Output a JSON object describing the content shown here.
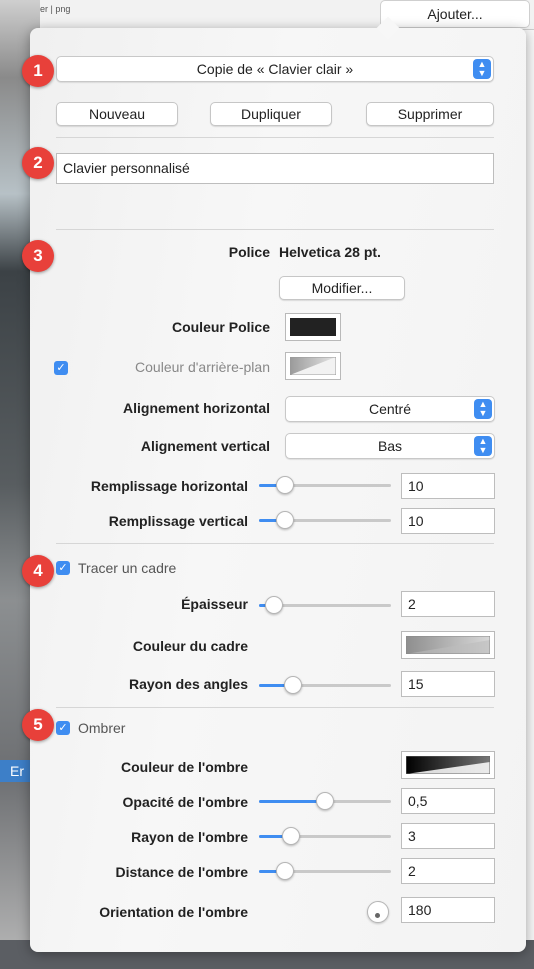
{
  "background": {
    "breadcrumb": "me dossier | png",
    "add_button": "Ajouter...",
    "strip_text": "Er"
  },
  "badges": [
    "1",
    "2",
    "3",
    "4",
    "5"
  ],
  "preset": {
    "selected": "Copie de « Clavier clair »",
    "new_label": "Nouveau",
    "duplicate_label": "Dupliquer",
    "delete_label": "Supprimer"
  },
  "name_field": {
    "value": "Clavier personnalisé"
  },
  "font": {
    "label": "Police",
    "value": "Helvetica 28 pt.",
    "modify_label": "Modifier...",
    "color_label": "Couleur Police",
    "color": "#222222",
    "bg_checked": true,
    "bg_label": "Couleur d'arrière-plan"
  },
  "alignment": {
    "h_label": "Alignement horizontal",
    "h_value": "Centré",
    "v_label": "Alignement vertical",
    "v_value": "Bas"
  },
  "padding": {
    "h_label": "Remplissage horizontal",
    "h_value": "10",
    "h_level": 0.15,
    "v_label": "Remplissage vertical",
    "v_value": "10",
    "v_level": 0.15
  },
  "border": {
    "checked": true,
    "label": "Tracer un cadre",
    "thickness_label": "Épaisseur",
    "thickness_value": "2",
    "thickness_level": 0.05,
    "color_label": "Couleur du cadre",
    "radius_label": "Rayon des angles",
    "radius_value": "15",
    "radius_level": 0.22
  },
  "shadow": {
    "checked": true,
    "label": "Ombrer",
    "color_label": "Couleur de l'ombre",
    "opacity_label": "Opacité de l'ombre",
    "opacity_value": "0,5",
    "opacity_level": 0.5,
    "radius_label": "Rayon de l'ombre",
    "radius_value": "3",
    "radius_level": 0.2,
    "distance_label": "Distance de l'ombre",
    "distance_value": "2",
    "distance_level": 0.15,
    "orientation_label": "Orientation de l'ombre",
    "orientation_value": "180"
  },
  "colors": {
    "accent": "#3f8df1",
    "badge": "#e8403a"
  }
}
